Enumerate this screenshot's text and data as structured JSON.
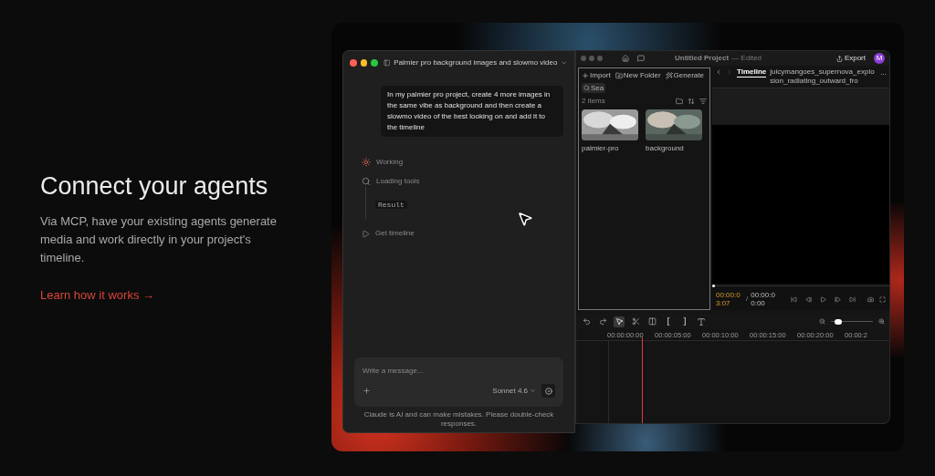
{
  "intro": {
    "heading": "Connect your agents",
    "body": "Via MCP, have your existing agents generate media and work directly in your project's timeline.",
    "link": "Learn how it works →"
  },
  "chat": {
    "title": "Palmier pro background images and slowmo video",
    "message": "In my palmier pro project, create 4 more images in the same vibe as background and then create a slowmo video of the best looking on and add it to the timeline",
    "steps": [
      {
        "kind": "status",
        "label": "Working"
      },
      {
        "kind": "search",
        "label": "Loading tools",
        "result": "Result"
      },
      {
        "kind": "tool",
        "label": "Get timeline"
      }
    ],
    "input": {
      "placeholder": "Write a message..."
    },
    "model": "Sonnet 4.6",
    "disclaimer": "Claude is AI and can make mistakes. Please double-check responses."
  },
  "editor": {
    "title": "Untitled Project",
    "status": "— Edited",
    "export": "Export",
    "avatar": "M",
    "media": {
      "actions": [
        {
          "kind": "import",
          "label": "Import"
        },
        {
          "kind": "folder",
          "label": "New Folder"
        },
        {
          "kind": "generate",
          "label": "Generate"
        }
      ],
      "search": {
        "placeholder": "Sea"
      },
      "count": "2 items",
      "items": [
        {
          "kind": "picture",
          "name": "palmier-pro"
        },
        {
          "kind": "picture",
          "name": "background"
        }
      ]
    },
    "tabs": [
      {
        "label": "Timeline",
        "selected": true
      },
      {
        "label": "juicymangoes_supernova_explosion_radiating_outward_fro",
        "selected": false
      }
    ],
    "more": "...",
    "player": {
      "current": "00:00:03:07",
      "separator": "/",
      "total": "00:00:00:00",
      "level": 0
    },
    "tools": [
      {
        "kind": "undo",
        "selected": false
      },
      {
        "kind": "redo",
        "selected": false
      },
      {
        "kind": "select",
        "selected": true
      },
      {
        "kind": "cut",
        "selected": false
      },
      {
        "kind": "split",
        "selected": false
      },
      {
        "kind": "mark-in",
        "label": "[",
        "selected": false
      },
      {
        "kind": "mark-out",
        "label": "]",
        "selected": false
      },
      {
        "kind": "text",
        "selected": false
      }
    ],
    "zoom": {
      "level": 0.1
    },
    "ruler": [
      "00:00:00:00",
      "00:00:05:00",
      "00:00:10:00",
      "00:00:15:00",
      "00:00:20:00",
      "00:00:2"
    ]
  }
}
